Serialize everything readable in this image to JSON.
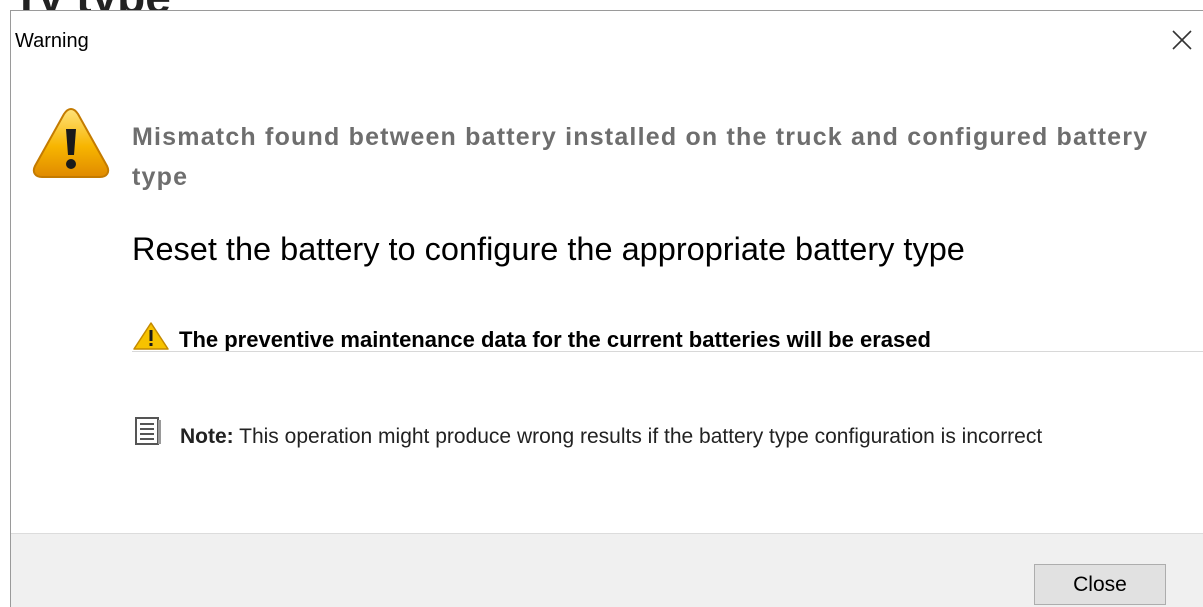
{
  "background": {
    "fragment_text": "ry type"
  },
  "dialog": {
    "title": "Warning",
    "close_icon": "close-icon",
    "warning_icon": "warning-triangle-icon",
    "headline": "Mismatch found between battery installed on the truck and configured battery type",
    "instruction": "Reset the battery to configure the appropriate battery type",
    "erase_warning": "The preventive maintenance data for the current batteries will be erased",
    "note_label": "Note:",
    "note_text": " This operation might produce wrong results if the battery type configuration is incorrect",
    "note_icon": "note-document-icon",
    "close_button_label": "Close"
  },
  "colors": {
    "warning_yellow": "#f7b500",
    "headline_gray": "#6e6e6e",
    "footer_bg": "#f0f0f0",
    "button_bg": "#e1e1e1"
  }
}
